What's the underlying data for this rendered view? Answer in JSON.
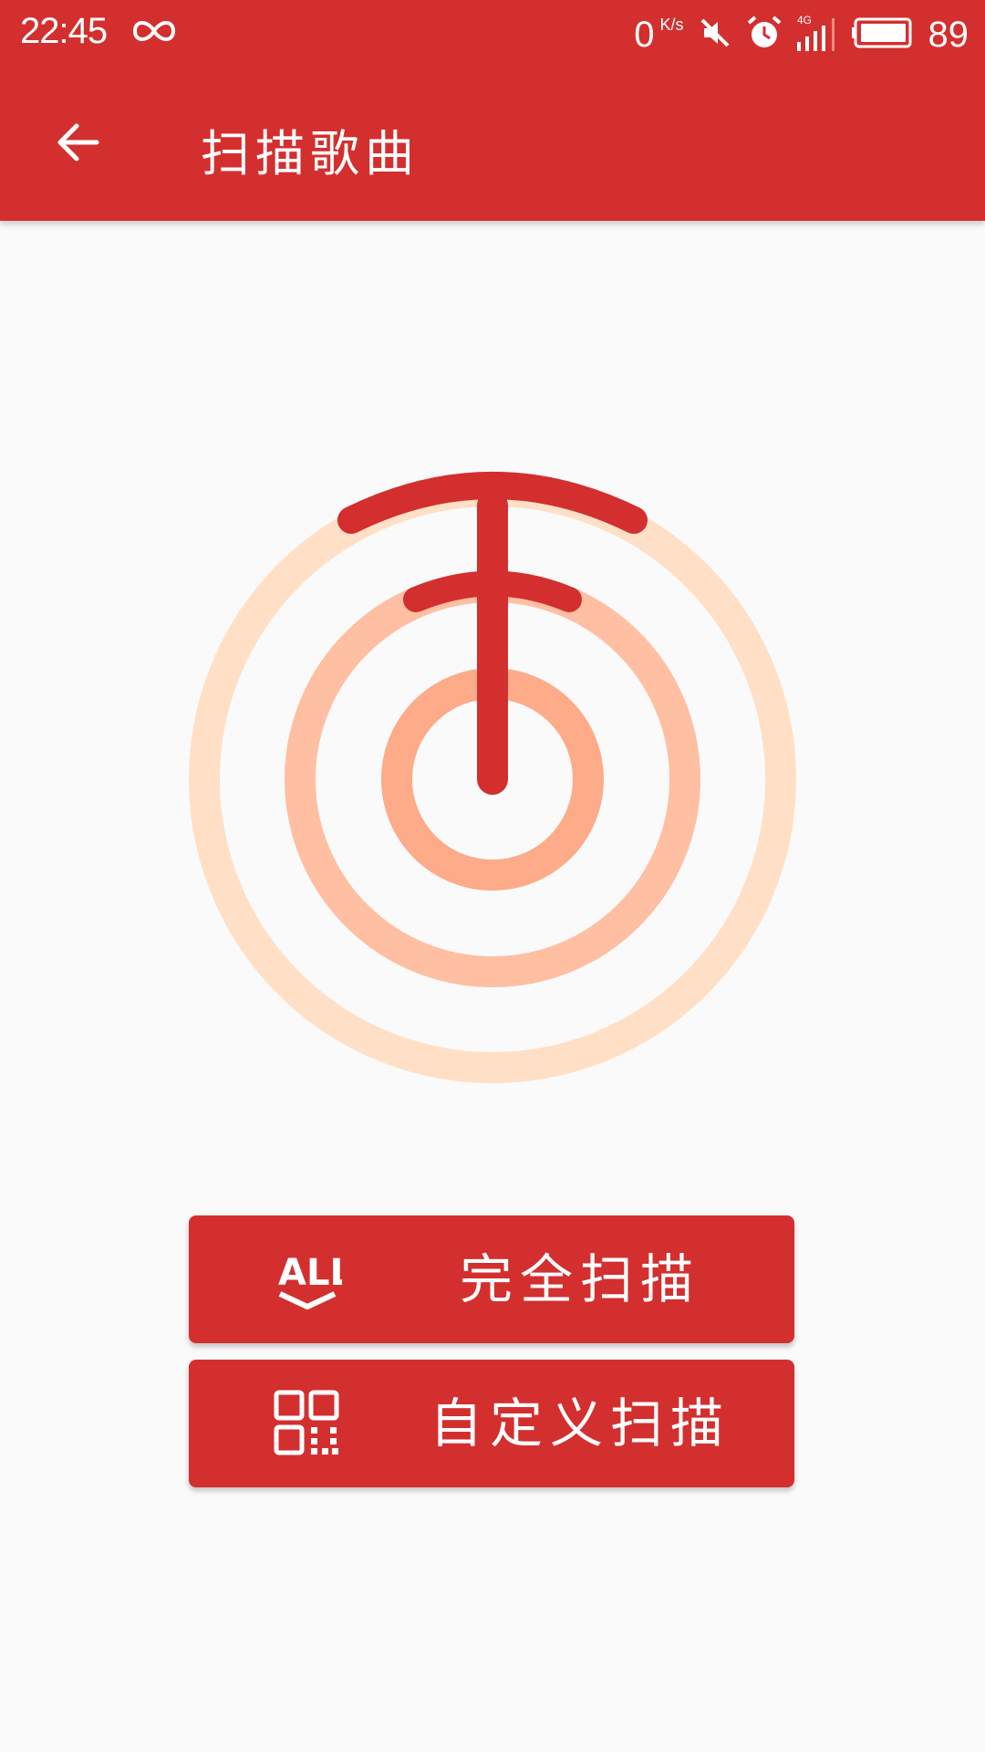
{
  "status_bar": {
    "time": "22:45",
    "net_speed": "0",
    "net_speed_unit": "K/s",
    "network_type": "4G",
    "battery": "89"
  },
  "app_bar": {
    "title": "扫描歌曲"
  },
  "buttons": {
    "full_scan": {
      "label": "完全扫描",
      "icon": "all-icon"
    },
    "custom_scan": {
      "label": "自定义扫描",
      "icon": "qr-grid-icon"
    }
  },
  "colors": {
    "primary": "#d32f2f",
    "ring_outer": "#ffe0c6",
    "ring_middle": "#ffbfa3",
    "ring_inner": "#fdab89",
    "background": "#fafafa"
  }
}
